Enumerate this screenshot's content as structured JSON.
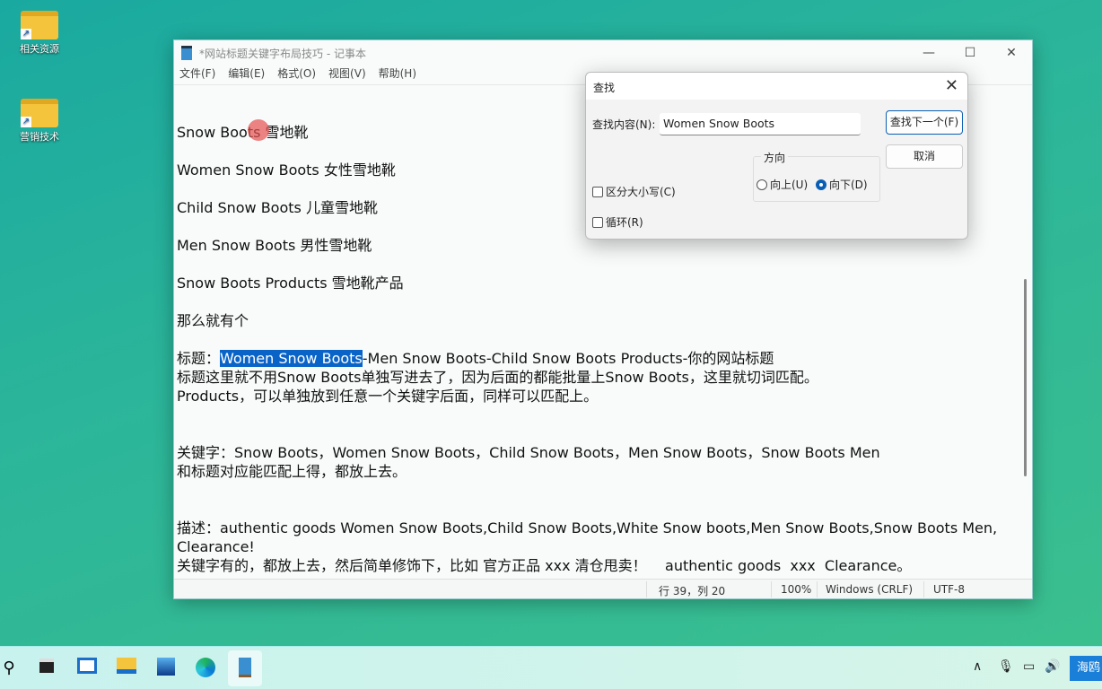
{
  "desktop": {
    "icons": [
      {
        "label": "相关资源"
      },
      {
        "label": "营销技术"
      }
    ]
  },
  "window": {
    "title": "*网站标题关键字布局技巧 - 记事本",
    "controls": [
      "—",
      "☐",
      "✕"
    ]
  },
  "menu": [
    "文件(F)",
    "编辑(E)",
    "格式(O)",
    "视图(V)",
    "帮助(H)"
  ],
  "document": {
    "lines": [
      "Snow Boots 雪地靴",
      "",
      "Women Snow Boots 女性雪地靴",
      "",
      "Child Snow Boots 儿童雪地靴",
      "",
      "Men Snow Boots 男性雪地靴",
      "",
      "Snow Boots Products 雪地靴产品",
      "",
      "那么就有个",
      "",
      null,
      "标题这里就不用Snow Boots单独写进去了，因为后面的都能批量上Snow Boots，这里就切词匹配。",
      "Products，可以单独放到任意一个关键字后面，同样可以匹配上。",
      "",
      "",
      "关键字：Snow Boots，Women Snow Boots，Child Snow Boots，Men Snow Boots，Snow Boots Men",
      "和标题对应能匹配上得，都放上去。",
      "",
      "",
      "描述：authentic goods Women Snow Boots,Child Snow Boots,White Snow boots,Men Snow Boots,Snow Boots Men,",
      "Clearance!",
      "关键字有的，都放上去，然后简单修饰下，比如 官方正品 xxx 清仓甩卖！    authentic goods  xxx  Clearance。"
    ],
    "title_line": {
      "prefix": "标题：",
      "highlight": "Women Snow Boots",
      "rest": "-Men Snow Boots-Child Snow Boots Products-你的网站标题"
    }
  },
  "status": {
    "position": "行 39，列 20",
    "zoom": "100%",
    "line_ending": "Windows (CRLF)",
    "encoding": "UTF-8"
  },
  "find_dialog": {
    "title": "查找",
    "find_label": "查找内容(N):",
    "find_value": "Women Snow Boots",
    "find_next": "查找下一个(F)",
    "cancel": "取消",
    "direction_label": "方向",
    "up": "向上(U)",
    "down": "向下(D)",
    "direction_selected": "down",
    "match_case": "区分大小写(C)",
    "match_case_checked": false,
    "wrap": "循环(R)",
    "wrap_checked": false
  },
  "taskbar": {
    "apps": [
      "search",
      "task-view",
      "widgets",
      "file-explorer",
      "photos",
      "edge",
      "notepad"
    ],
    "ime": "海鸥"
  },
  "colors": {
    "selection": "#0a64c8",
    "accent": "#0a5fb4"
  }
}
